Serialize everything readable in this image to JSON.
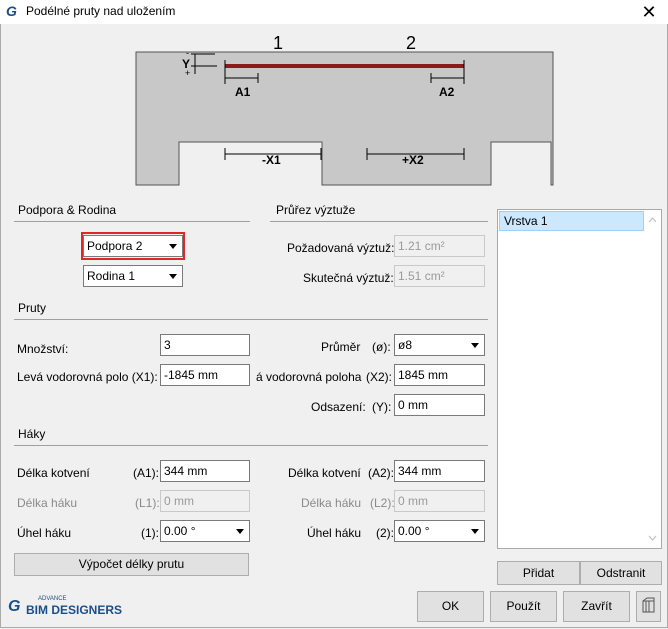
{
  "window": {
    "title": "Podélné pruty nad uložením",
    "close_symbol": "✕"
  },
  "diagram": {
    "labels": {
      "support1": "1",
      "support2": "2",
      "a1": "A1",
      "a2": "A2",
      "x1": "-X1",
      "x2": "+X2",
      "y": "Y",
      "plus": "+",
      "minus": "-"
    },
    "colors": {
      "concrete": "#c8c8c8",
      "rebar": "#8b1a1a"
    }
  },
  "support_family": {
    "heading": "Podpora & Rodina",
    "support_select": "Podpora 2",
    "family_select": "Rodina 1"
  },
  "cross_section": {
    "heading": "Průřez výztuže",
    "required_label": "Požadovaná výztuž:",
    "required_value": "1.21 cm²",
    "actual_label": "Skutečná výztuž:",
    "actual_value": "1.51 cm²"
  },
  "bars": {
    "heading": "Pruty",
    "quantity_label": "Množství:",
    "quantity_value": "3",
    "diameter_label": "Průměr",
    "diameter_symbol": "(ø):",
    "diameter_value": "ø8",
    "left_pos_label": "Levá vodorovná polo (X1):",
    "left_pos_value": "-1845 mm",
    "right_pos_label": "á vodorovná poloha",
    "right_pos_symbol": "(X2):",
    "right_pos_value": "1845 mm",
    "offset_label": "Odsazení:",
    "offset_symbol": "(Y):",
    "offset_value": "0 mm"
  },
  "hooks": {
    "heading": "Háky",
    "anchor_label_1": "Délka kotvení",
    "anchor_symbol_1": "(A1):",
    "anchor_value_1": "344 mm",
    "anchor_label_2": "Délka kotvení",
    "anchor_symbol_2": "(A2):",
    "anchor_value_2": "344 mm",
    "hook_len_label_1": "Délka háku",
    "hook_len_symbol_1": "(L1):",
    "hook_len_value_1": "0 mm",
    "hook_len_label_2": "Délka háku",
    "hook_len_symbol_2": "(L2):",
    "hook_len_value_2": "0 mm",
    "hook_angle_label_1": "Úhel háku",
    "hook_angle_symbol_1": "(1):",
    "hook_angle_value_1": "0.00 °",
    "hook_angle_label_2": "Úhel háku",
    "hook_angle_symbol_2": "(2):",
    "hook_angle_value_2": "0.00 °",
    "compute_button": "Výpočet délky prutu"
  },
  "layers": {
    "items": [
      "Vrstva 1"
    ],
    "add_button": "Přidat",
    "remove_button": "Odstranit"
  },
  "footer": {
    "logo_top": "ADVANCE",
    "logo_main": "BIM DESIGNERS",
    "ok": "OK",
    "apply": "Použít",
    "close": "Zavřít"
  }
}
